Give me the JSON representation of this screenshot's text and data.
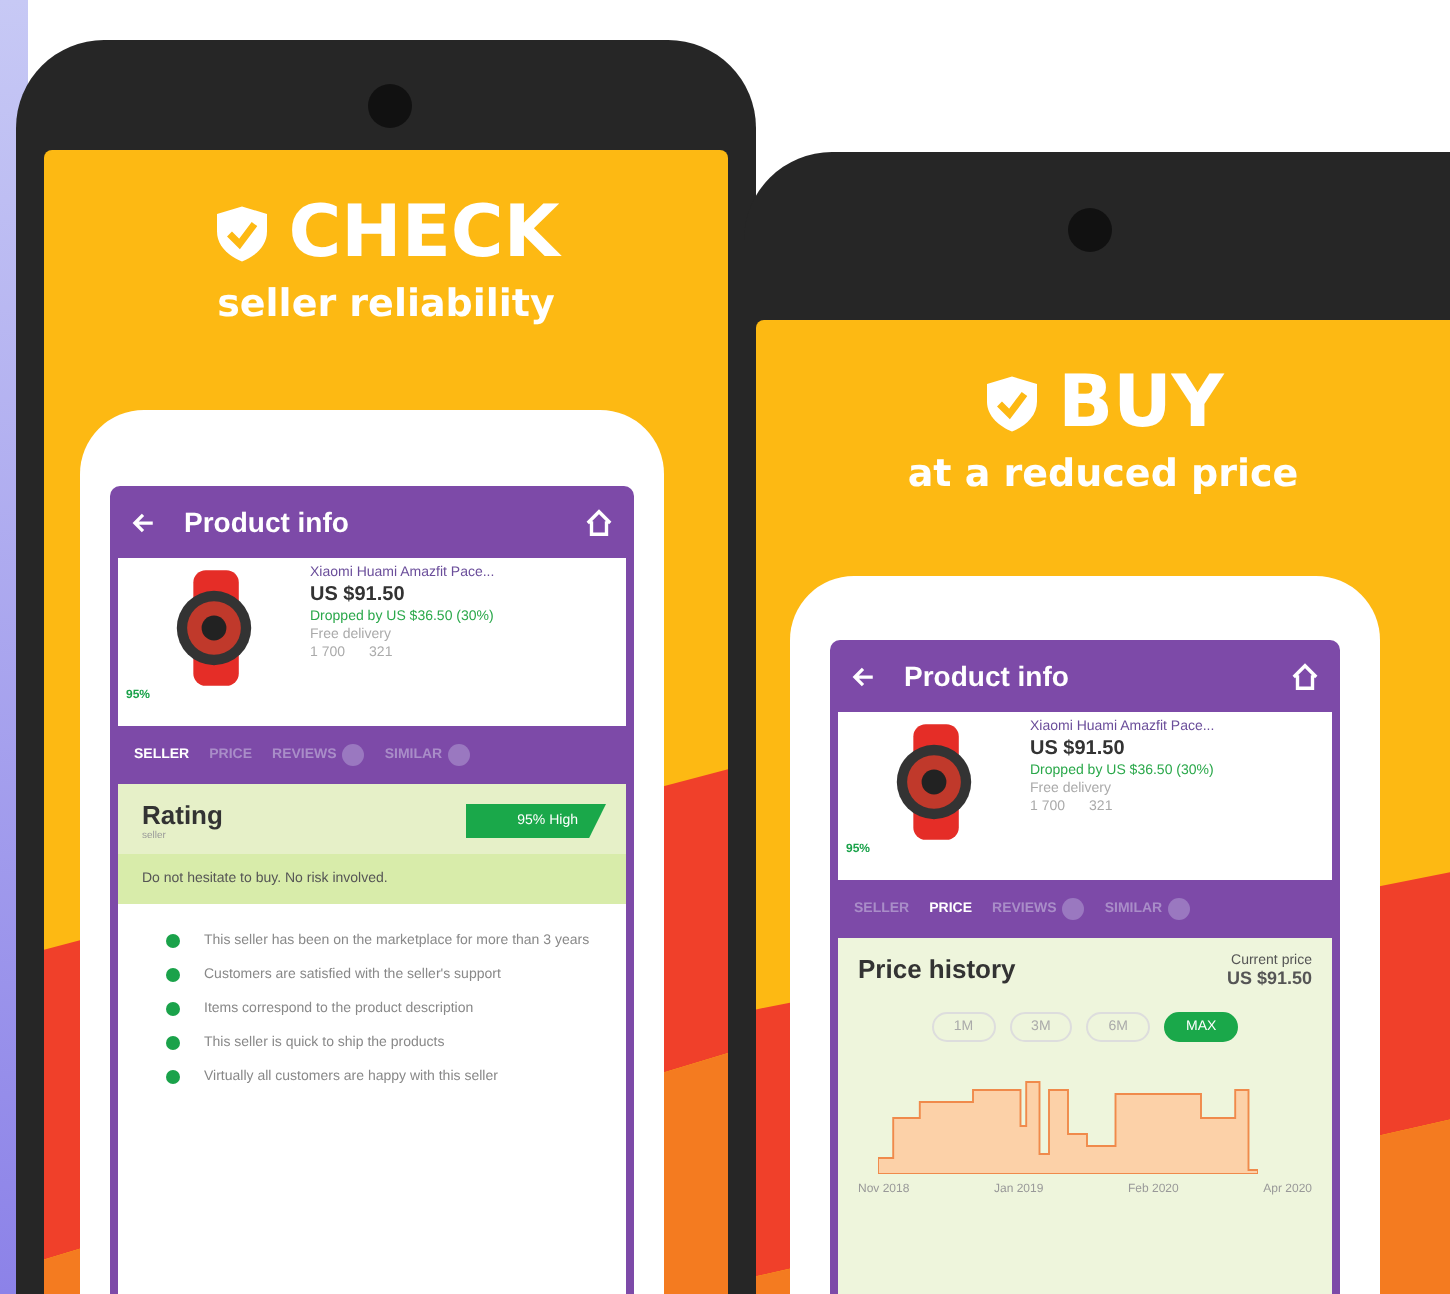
{
  "panels": [
    {
      "headline": "CHECK",
      "subline": "seller reliability",
      "app": {
        "title": "Product info",
        "product": {
          "name": "Xiaomi Huami Amazfit Pace...",
          "price": "US $91.50",
          "drop": "Dropped by US $36.50 (30%)",
          "delivery": "Free delivery",
          "orders": "1 700",
          "reviews": "321",
          "score": "95%"
        },
        "tabs": [
          {
            "label": "SELLER",
            "selected": true,
            "kind": "plain"
          },
          {
            "label": "PRICE",
            "selected": false,
            "kind": "plain"
          },
          {
            "label": "REVIEWS",
            "selected": false,
            "kind": "counter"
          },
          {
            "label": "SIMILAR",
            "selected": false,
            "kind": "counter"
          }
        ],
        "content": {
          "kind": "rating",
          "title": "Rating",
          "subtitle": "seller",
          "score": "95% High",
          "verdict": "Do not hesitate to buy. No risk involved.",
          "points": [
            "This seller has been on the marketplace for more than 3 years",
            "Customers are satisfied with the seller's support",
            "Items correspond to the product description",
            "This seller is quick to ship the products",
            "Virtually all customers are happy with this seller"
          ]
        }
      }
    },
    {
      "headline": "BUY",
      "subline": "at a reduced price",
      "app": {
        "title": "Product info",
        "product": {
          "name": "Xiaomi Huami Amazfit Pace...",
          "price": "US $91.50",
          "drop": "Dropped by US $36.50 (30%)",
          "delivery": "Free delivery",
          "orders": "1 700",
          "reviews": "321",
          "score": "95%"
        },
        "tabs": [
          {
            "label": "SELLER",
            "selected": false,
            "kind": "plain"
          },
          {
            "label": "PRICE",
            "selected": true,
            "kind": "plain"
          },
          {
            "label": "REVIEWS",
            "selected": false,
            "kind": "counter"
          },
          {
            "label": "SIMILAR",
            "selected": false,
            "kind": "counter"
          }
        ],
        "content": {
          "kind": "price",
          "title": "Price history",
          "current_label": "Current price",
          "current_value": "US $91.50",
          "ranges": [
            {
              "label": "1M",
              "selected": false
            },
            {
              "label": "3M",
              "selected": false
            },
            {
              "label": "6M",
              "selected": false
            },
            {
              "label": "MAX",
              "selected": true
            }
          ],
          "x_labels": [
            "Nov 2018",
            "Jan 2019",
            "Feb 2020",
            "Apr 2020"
          ]
        }
      }
    }
  ]
}
